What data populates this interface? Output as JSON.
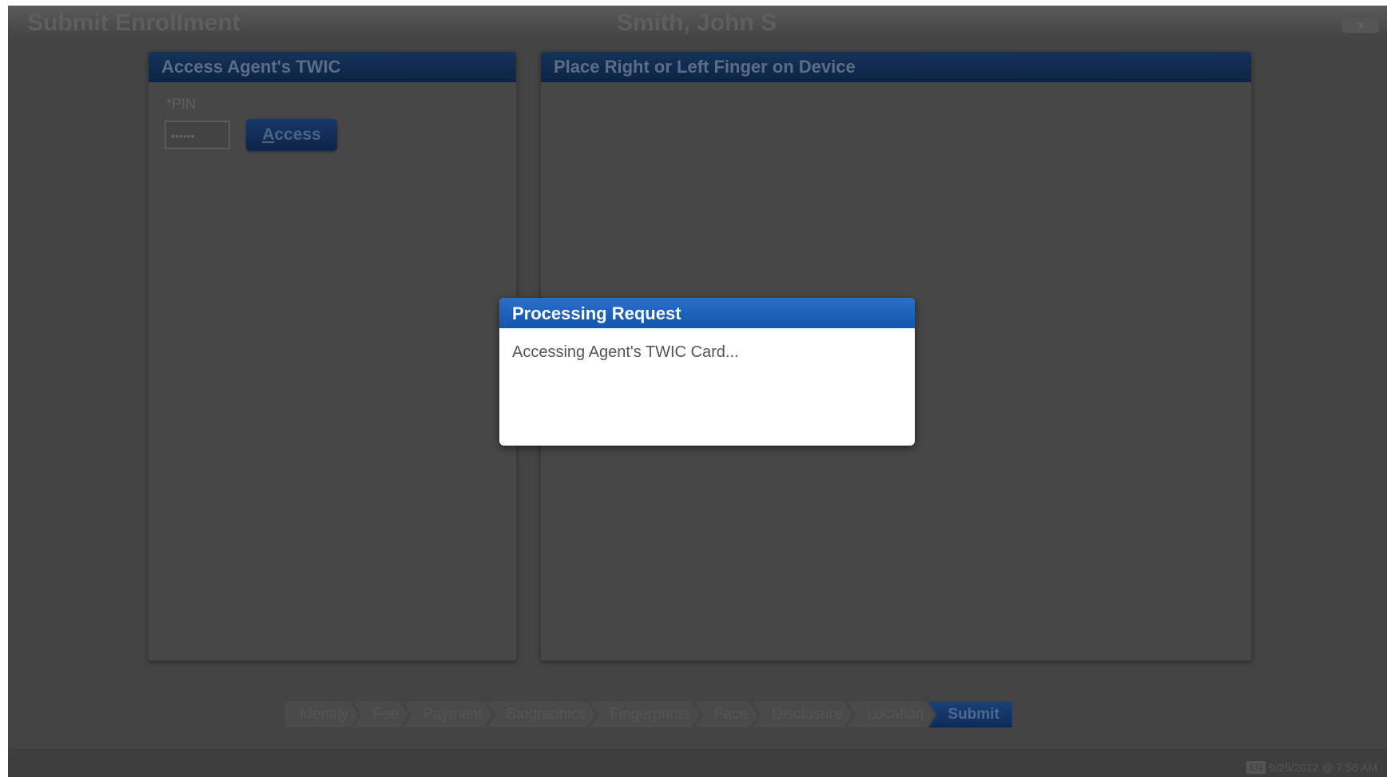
{
  "header": {
    "title": "Submit Enrollment",
    "applicant_name": "Smith, John S",
    "close_label": "x"
  },
  "left_panel": {
    "title": "Access Agent's TWIC",
    "pin_label": "*PIN",
    "pin_value": "••••••",
    "access_button_label_first": "A",
    "access_button_label_rest": "ccess"
  },
  "right_panel": {
    "title": "Place Right or Left Finger on Device"
  },
  "modal": {
    "title": "Processing Request",
    "message": "Accessing Agent's TWIC Card..."
  },
  "steps": [
    {
      "label": "Identity"
    },
    {
      "label": "Fee"
    },
    {
      "label": "Payment"
    },
    {
      "label": "Biographics"
    },
    {
      "label": "Fingerprints"
    },
    {
      "label": "Face"
    },
    {
      "label": "Disclosure"
    },
    {
      "label": "Location"
    },
    {
      "label": "Submit",
      "active": true
    }
  ],
  "status": {
    "language": "EN",
    "datetime": "9/25/2012 @ 7:56 AM"
  },
  "colors": {
    "backdrop": "#444444",
    "modal_header": "#1455ad",
    "panel_header": "#0c2445"
  }
}
